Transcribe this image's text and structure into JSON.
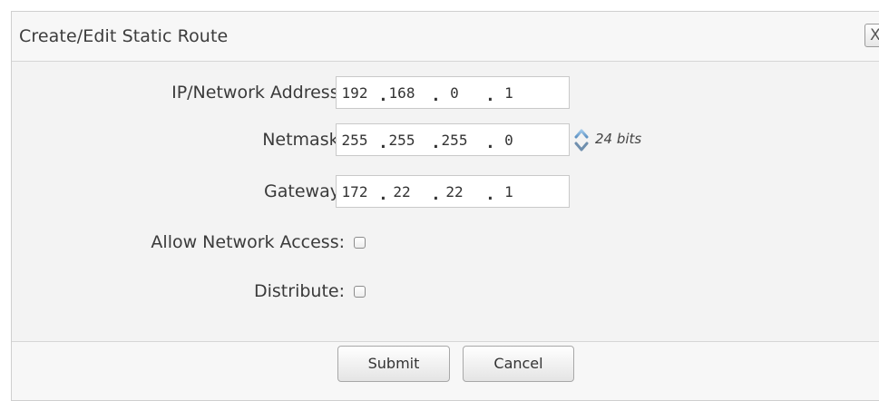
{
  "dialog": {
    "title": "Create/Edit Static Route",
    "close_label": "X"
  },
  "form": {
    "ip_address": {
      "label": "IP/Network Address:",
      "octets": [
        "192",
        "168",
        "0",
        "1"
      ]
    },
    "netmask": {
      "label": "Netmask:",
      "octets": [
        "255",
        "255",
        "255",
        "0"
      ],
      "bits_text": "24 bits"
    },
    "gateway": {
      "label": "Gateway:",
      "octets": [
        "172",
        "22",
        "22",
        "1"
      ]
    },
    "allow_network_access": {
      "label": "Allow Network Access:",
      "checked": false
    },
    "distribute": {
      "label": "Distribute:",
      "checked": false
    }
  },
  "footer": {
    "submit_label": "Submit",
    "cancel_label": "Cancel"
  },
  "icons": {
    "spinner_up": "chevron-up-icon",
    "spinner_down": "chevron-down-icon",
    "close": "close-icon"
  }
}
